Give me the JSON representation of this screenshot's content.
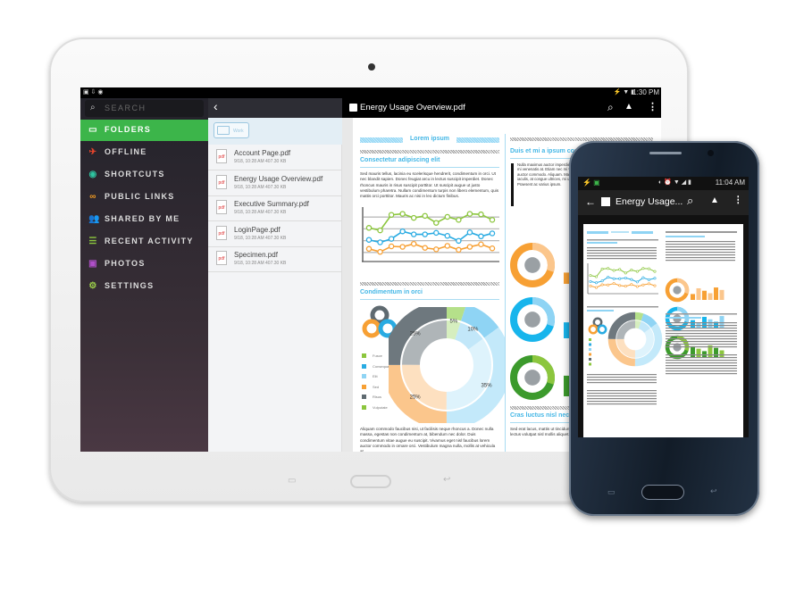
{
  "tablet": {
    "status": {
      "time": "1:30 PM"
    },
    "sidebar": {
      "search_placeholder": "SEARCH",
      "items": [
        {
          "label": "FOLDERS",
          "icon": "folder-icon",
          "color": "#ffffff",
          "active": true
        },
        {
          "label": "OFFLINE",
          "icon": "airplane-icon",
          "color": "#e8452c"
        },
        {
          "label": "SHORTCUTS",
          "icon": "shortcut-icon",
          "color": "#2ec4a0"
        },
        {
          "label": "PUBLIC LINKS",
          "icon": "link-icon",
          "color": "#f39c21"
        },
        {
          "label": "SHARED BY ME",
          "icon": "shared-user-icon",
          "color": "#3ab0e8"
        },
        {
          "label": "RECENT ACTIVITY",
          "icon": "list-icon",
          "color": "#8cc63e"
        },
        {
          "label": "PHOTOS",
          "icon": "photo-icon",
          "color": "#b04fc9"
        },
        {
          "label": "SETTINGS",
          "icon": "gear-icon",
          "color": "#9ccf4a"
        }
      ]
    },
    "filelist": {
      "folder_chip": "Work",
      "files": [
        {
          "name": "Account Page.pdf",
          "meta": "9/18, 10:28 AM   407.30 KB"
        },
        {
          "name": "Energy Usage Overview.pdf",
          "meta": "9/18, 10:28 AM   407.30 KB"
        },
        {
          "name": "Executive Summary.pdf",
          "meta": "9/18, 10:28 AM   407.30 KB"
        },
        {
          "name": "LoginPage.pdf",
          "meta": "9/18, 10:28 AM   407.30 KB"
        },
        {
          "name": "Specimen.pdf",
          "meta": "9/18, 10:28 AM   407.30 KB"
        }
      ]
    },
    "viewer": {
      "title": "Energy Usage Overview.pdf",
      "doc": {
        "header": "Lorem ipsum",
        "h1": "Consectetur adipiscing elit",
        "p1": "Sed mauris tellus, lacinia eu scelerisque hendrerit, condimentum in orci. Ut nec blandit sapien. Donec feugiat arcu in lectus suscipit imperdiet. Donec rhoncus mauris in risus suscipit porttitor. Ut suscipit augue ut justo vestibulum pharetra. Nullam condimentum turpis non libero elementum, quis mattis orci porttitor. Mauris ac nisi in leo dictum finibus.",
        "h2": "Condimentum in orci",
        "p2": "Aliquam commodo faucibus nisi, ut facilisis neque rhoncus a. Donec nulla massa, egestas non condimentum at, bibendum nec dolor. Duis condimentum vitae augue eu suscipit. Vivamus eget nisl faucibus lorem auctor commodo in ornare orci. Vestibulum magna nulla, mollis at vehicula at.",
        "r_h1": "Duis et mi a ipsum consequat",
        "r_quote": "Nulla maximus auctor imperdiet. Fusce quis gravida lectus scelerisque, mi venenatis at. Etiam nec mi vitae sapien vulputate maximus vitae auctor commodo. Aliquam. Maecenas gravida nibh quis sapien vel ipsum iaculis, at congue ultrices, mi ut amet euismod faucibus erat nibh at ante. Praesent ac varius ipsum.",
        "r_h2": "Cras luctus nisl nec",
        "r_p": "Sed erat lacus, mattis ut tincidunt, lectus volutpat nisl mollis aliquet."
      }
    }
  },
  "phone": {
    "status": {
      "time": "11:04 AM"
    },
    "title": "Energy Usage..."
  },
  "colors": {
    "green": "#8cc63e",
    "blue": "#29abe2",
    "lightblue": "#9ddcf5",
    "orange": "#f7a034",
    "grey": "#5f6a70",
    "accent": "#3cb54a"
  },
  "chart_data": [
    {
      "type": "line",
      "series": [
        {
          "color": "#8cc63e",
          "values": [
            62,
            57,
            88,
            90,
            82,
            86,
            72,
            84,
            78,
            90,
            89,
            78
          ]
        },
        {
          "color": "#29abe2",
          "values": [
            38,
            33,
            40,
            55,
            49,
            49,
            52,
            46,
            36,
            53,
            45,
            51
          ]
        },
        {
          "color": "#f7a034",
          "values": [
            20,
            14,
            25,
            24,
            30,
            22,
            19,
            26,
            18,
            24,
            29,
            21
          ]
        }
      ]
    },
    {
      "type": "pie",
      "categories": [
        "Fusce",
        "Consequat",
        "Elit",
        "Sed",
        "Risus",
        "Vulputate"
      ],
      "labels": [
        "5%",
        "10%",
        "35%",
        "25%",
        "25%"
      ],
      "values": [
        5,
        10,
        35,
        25,
        25
      ],
      "colors": [
        "#b5e08a",
        "#8fd4f4",
        "#c3e9fa",
        "#fbc68c",
        "#6e787e"
      ],
      "legend_colors": [
        "#8cc63e",
        "#29abe2",
        "#8fd4f4",
        "#f7a034",
        "#5f6a70",
        "#8cc63e"
      ]
    }
  ]
}
